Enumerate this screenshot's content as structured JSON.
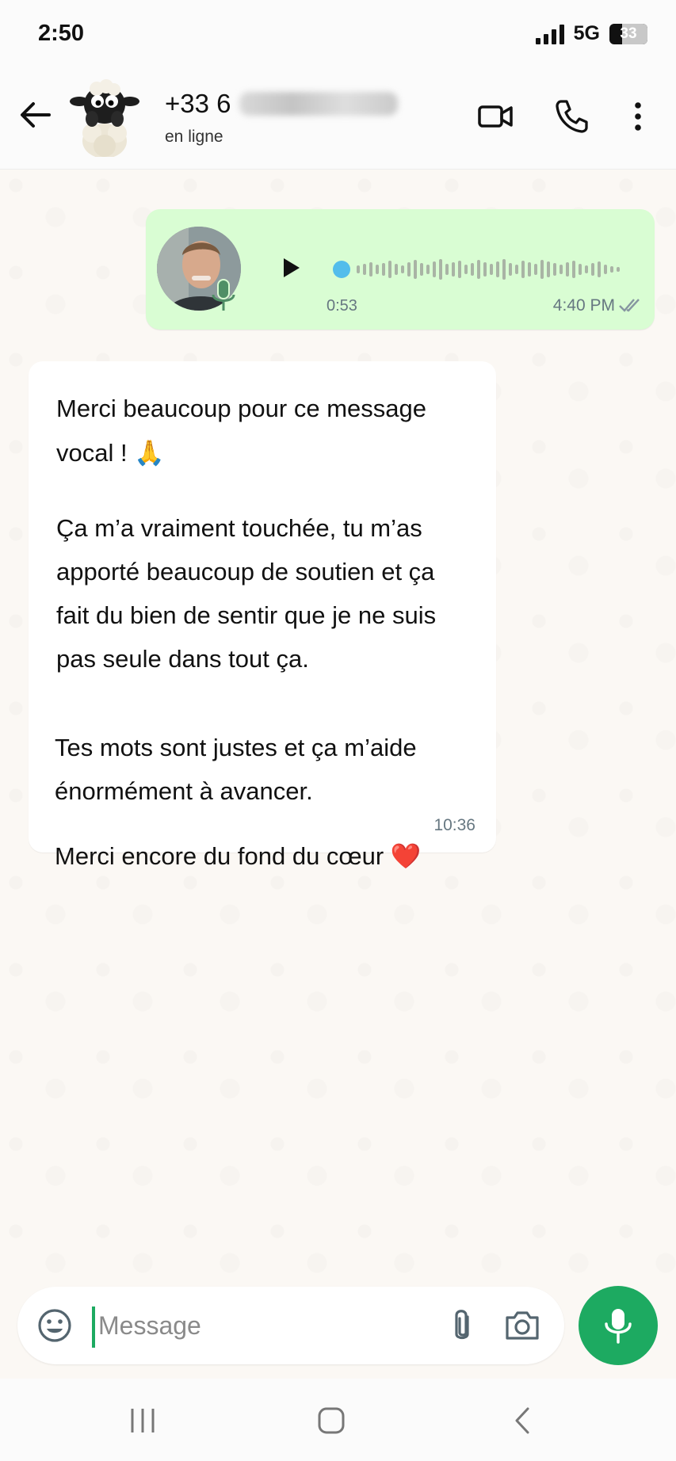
{
  "status": {
    "time": "2:50",
    "network": "5G",
    "battery": "33",
    "battery_level": 0.33
  },
  "header": {
    "contact_name": "+33 6",
    "contact_status": "en ligne"
  },
  "voice_message": {
    "duration": "0:53",
    "time": "4:40 PM"
  },
  "text_message": {
    "lines": [
      "Merci beaucoup pour ce message",
      "vocal ! 🙏",
      "Ça m’a vraiment touchée, tu m’as",
      "apporté beaucoup de soutien et ça",
      "fait du bien de sentir que je ne suis",
      "pas seule dans tout ça.",
      "Tes mots sont justes et ça m’aide",
      "énormément à avancer.",
      "Merci encore du fond du cœur ❤️"
    ],
    "time": "10:36"
  },
  "composer": {
    "placeholder": "Message"
  },
  "colors": {
    "outgoing_bubble": "#d9fdd3",
    "accent_green": "#1daa61",
    "waveform_dot": "#53bdeb",
    "chat_background": "#fbf8f4"
  },
  "icons": {
    "back": "arrow-left-icon",
    "video": "video-call-icon",
    "phone": "phone-icon",
    "menu": "more-vertical-icon",
    "emoji": "emoji-icon",
    "attach": "paperclip-icon",
    "camera": "camera-icon",
    "mic": "mic-icon"
  }
}
